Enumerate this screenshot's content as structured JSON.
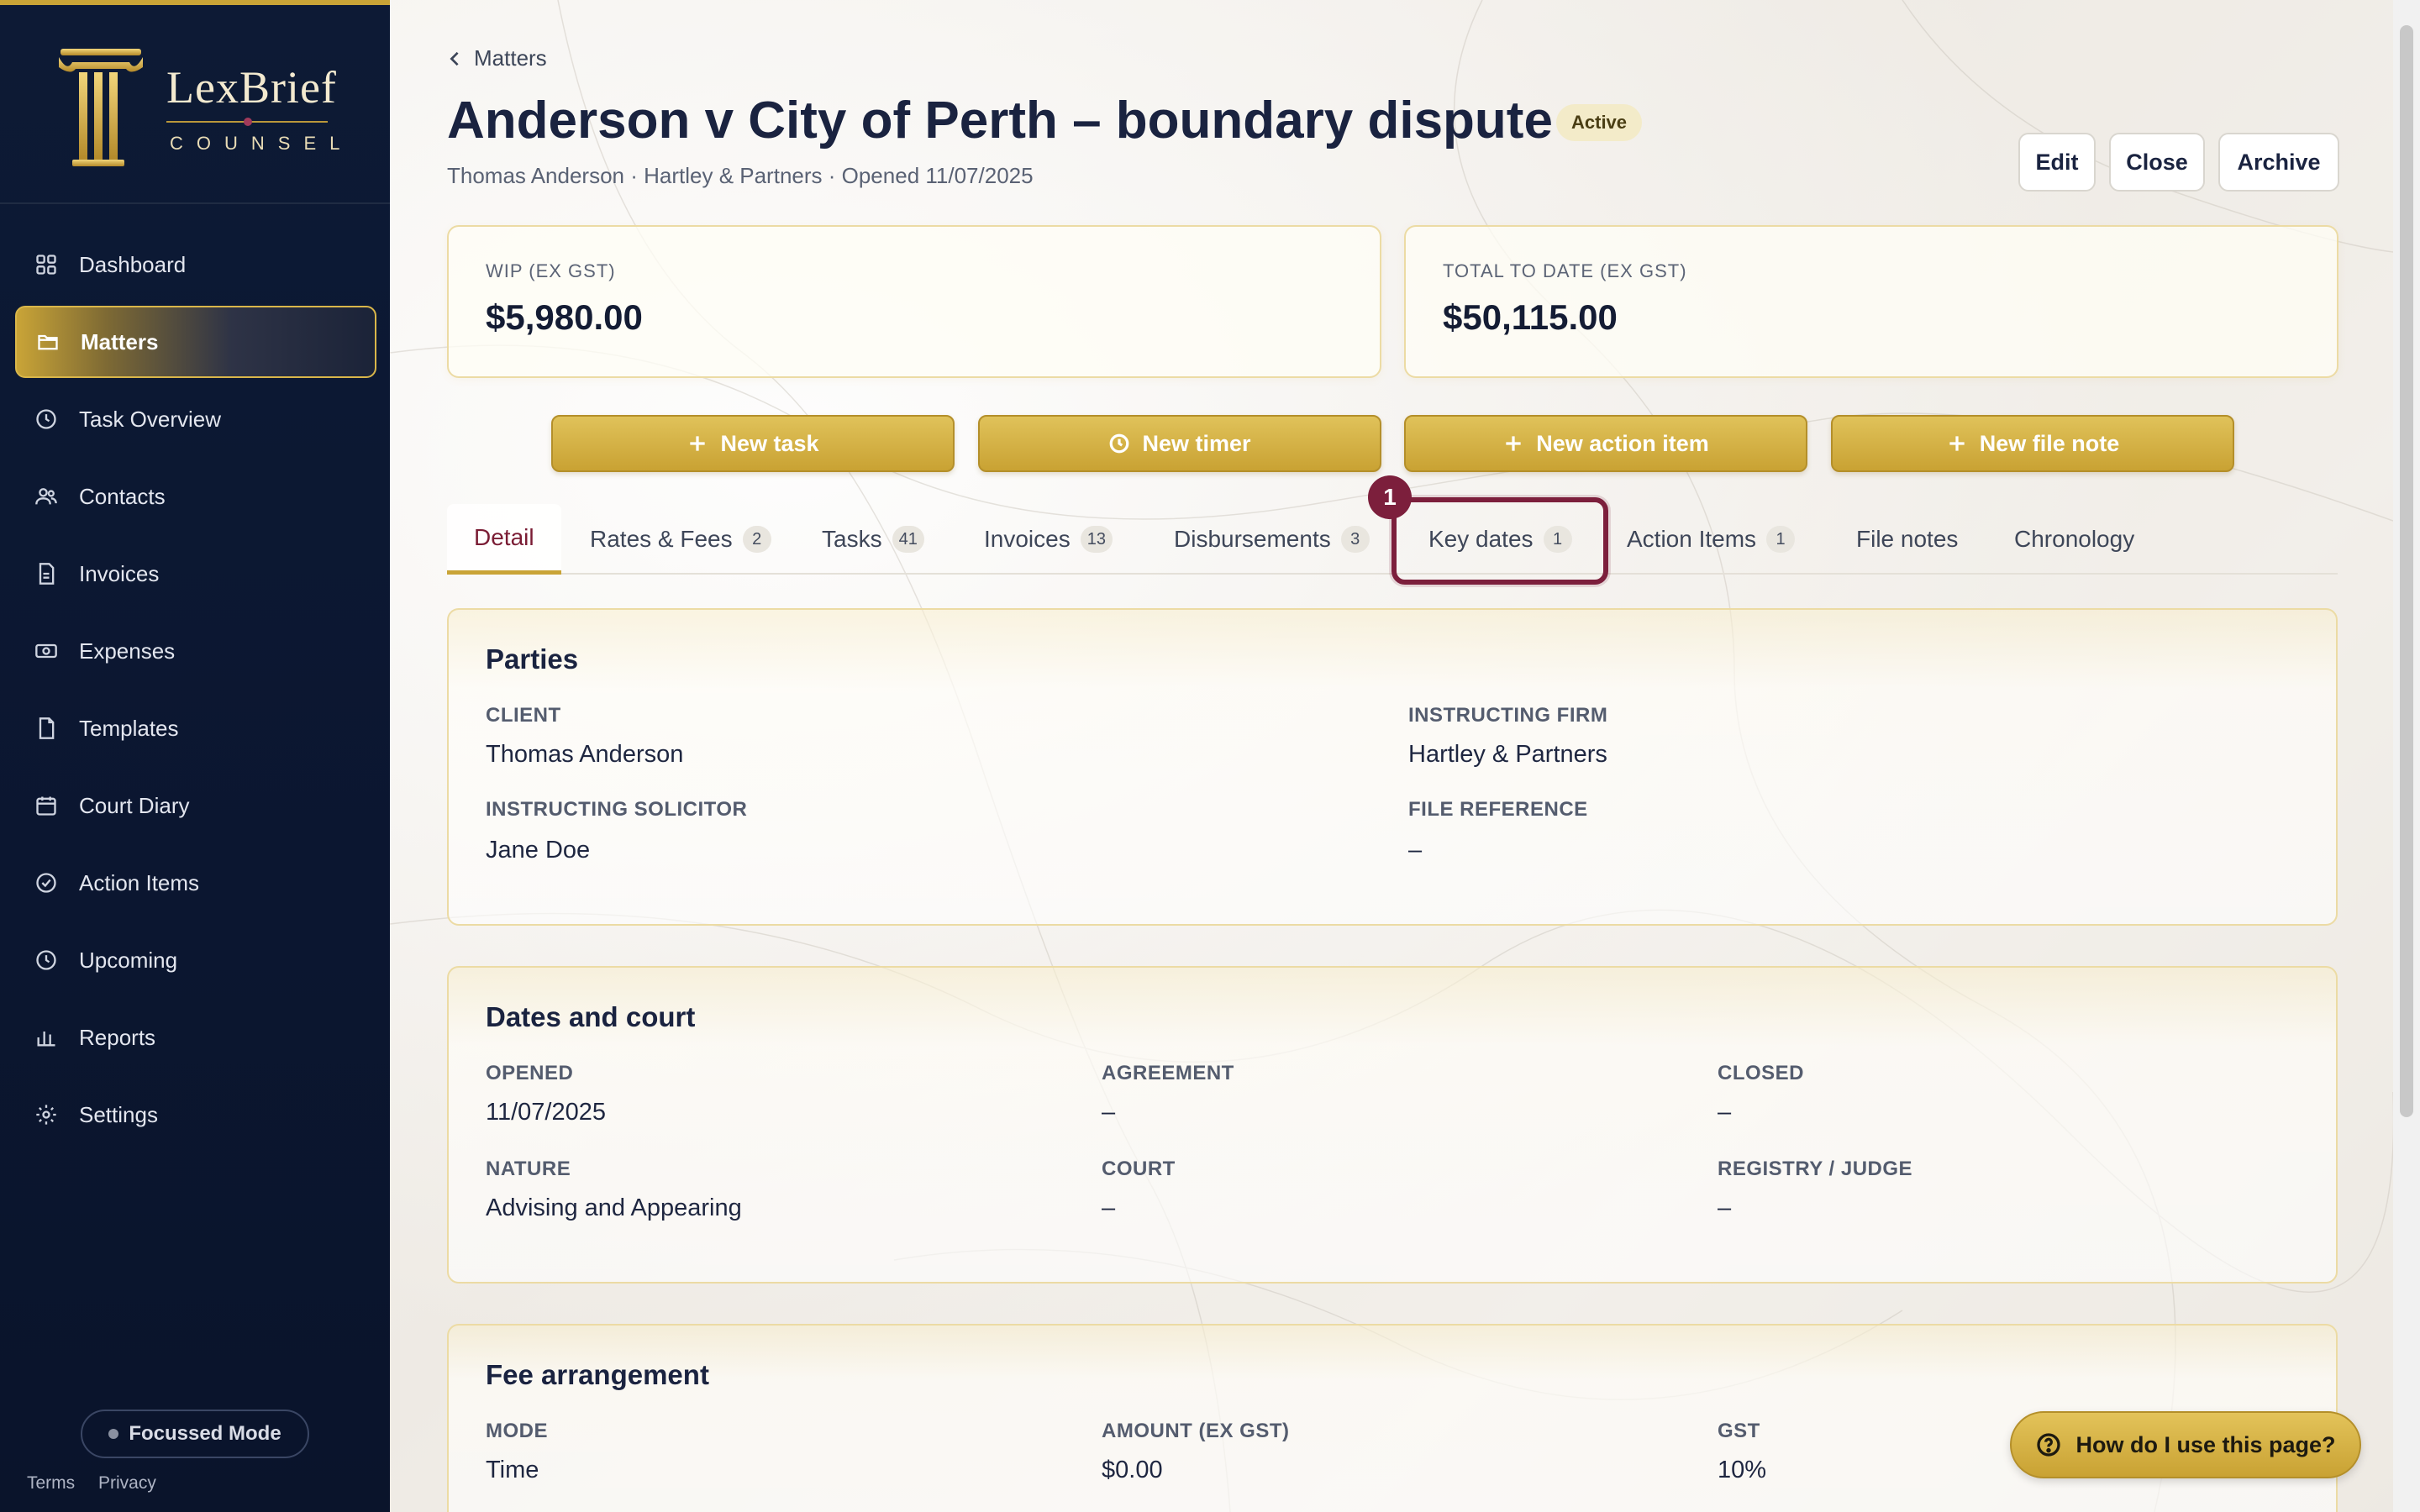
{
  "brand": {
    "name": "LexBrief",
    "sub": "COUNSEL"
  },
  "sidebar": {
    "items": [
      {
        "label": "Dashboard",
        "icon": "grid-icon"
      },
      {
        "label": "Matters",
        "icon": "folder-icon",
        "active": true
      },
      {
        "label": "Task Overview",
        "icon": "clock-icon"
      },
      {
        "label": "Contacts",
        "icon": "users-icon"
      },
      {
        "label": "Invoices",
        "icon": "document-icon"
      },
      {
        "label": "Expenses",
        "icon": "cash-icon"
      },
      {
        "label": "Templates",
        "icon": "file-icon"
      },
      {
        "label": "Court Diary",
        "icon": "calendar-icon"
      },
      {
        "label": "Action Items",
        "icon": "check-circle-icon"
      },
      {
        "label": "Upcoming",
        "icon": "clock-icon"
      },
      {
        "label": "Reports",
        "icon": "bar-chart-icon"
      },
      {
        "label": "Settings",
        "icon": "gear-icon"
      }
    ],
    "focus_mode": "Focussed Mode",
    "footer": {
      "terms": "Terms",
      "privacy": "Privacy"
    }
  },
  "breadcrumb": {
    "label": "Matters"
  },
  "matter": {
    "title": "Anderson v City of Perth – boundary dispute",
    "status": "Active",
    "subtitle": "Thomas Anderson · Hartley & Partners · Opened 11/07/2025"
  },
  "header_actions": {
    "edit": "Edit",
    "close": "Close",
    "archive": "Archive"
  },
  "stats": {
    "wip_label": "WIP (EX GST)",
    "wip_value": "$5,980.00",
    "total_label": "TOTAL TO DATE (EX GST)",
    "total_value": "$50,115.00"
  },
  "actions": {
    "new_task": "New task",
    "new_timer": "New timer",
    "new_action_item": "New action item",
    "new_file_note": "New file note"
  },
  "tabs": [
    {
      "label": "Detail",
      "count": ""
    },
    {
      "label": "Rates & Fees",
      "count": "2"
    },
    {
      "label": "Tasks",
      "count": "41"
    },
    {
      "label": "Invoices",
      "count": "13"
    },
    {
      "label": "Disbursements",
      "count": "3"
    },
    {
      "label": "Key dates",
      "count": "1"
    },
    {
      "label": "Action Items",
      "count": "1"
    },
    {
      "label": "File notes",
      "count": ""
    },
    {
      "label": "Chronology",
      "count": ""
    }
  ],
  "highlight_marker": "1",
  "parties": {
    "title": "Parties",
    "client_label": "CLIENT",
    "client": "Thomas Anderson",
    "firm_label": "INSTRUCTING FIRM",
    "firm": "Hartley & Partners",
    "solicitor_label": "INSTRUCTING SOLICITOR",
    "solicitor": "Jane Doe",
    "fileref_label": "FILE REFERENCE",
    "fileref": "–"
  },
  "dates": {
    "title": "Dates and court",
    "opened_label": "OPENED",
    "opened": "11/07/2025",
    "agreement_label": "AGREEMENT",
    "agreement": "–",
    "closed_label": "CLOSED",
    "closed": "–",
    "nature_label": "NATURE",
    "nature": "Advising and Appearing",
    "court_label": "COURT",
    "court": "–",
    "registry_label": "REGISTRY / JUDGE",
    "registry": "–"
  },
  "fees": {
    "title": "Fee arrangement",
    "mode_label": "MODE",
    "mode": "Time",
    "amount_label": "AMOUNT (EX GST)",
    "amount": "$0.00",
    "gst_label": "GST",
    "gst": "10%"
  },
  "help": {
    "label": "How do I use this page?"
  },
  "colors": {
    "gold": "#c9a437",
    "navy": "#0d1a35",
    "burgundy": "#7c1f3c"
  }
}
